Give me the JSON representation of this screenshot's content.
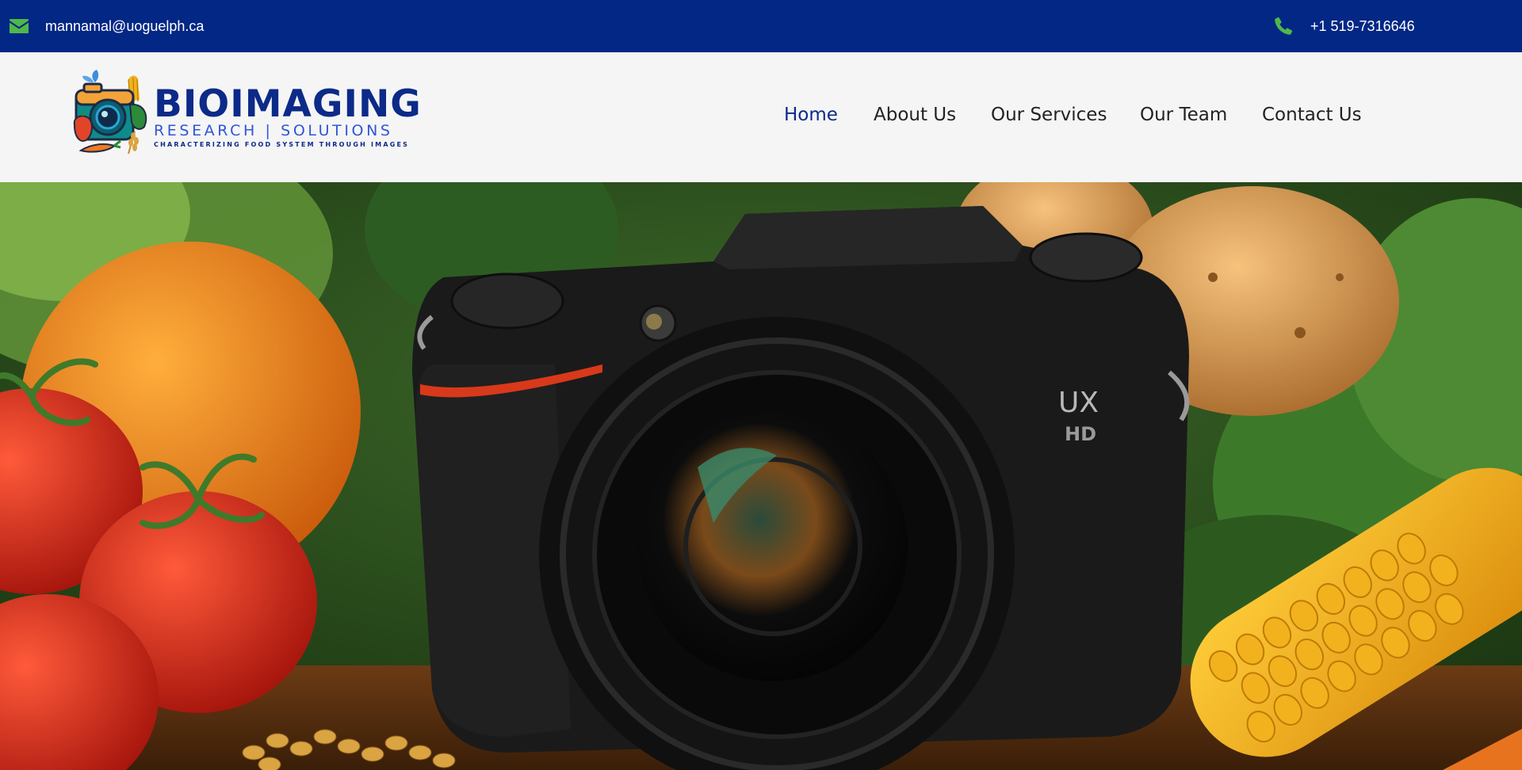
{
  "topbar": {
    "email": "mannamal@uoguelph.ca",
    "phone": "+1 519-7316646",
    "email_icon": "envelope-icon",
    "phone_icon": "phone-icon",
    "background": "#022785",
    "icon_color": "#4fb84a"
  },
  "brand": {
    "title": "BIOIMAGING",
    "subtitle": "RESEARCH | SOLUTIONS",
    "tagline": "CHARACTERIZING FOOD SYSTEM THROUGH IMAGES",
    "primary_color": "#0c2a88",
    "secondary_color": "#2f56d6"
  },
  "nav": {
    "items": [
      {
        "label": "Home",
        "active": true
      },
      {
        "label": "About Us",
        "active": false
      },
      {
        "label": "Our Services",
        "active": false
      },
      {
        "label": "Our Team",
        "active": false
      },
      {
        "label": "Contact Us",
        "active": false
      }
    ]
  },
  "hero": {
    "camera_brand": "UX",
    "camera_model": "HD"
  }
}
